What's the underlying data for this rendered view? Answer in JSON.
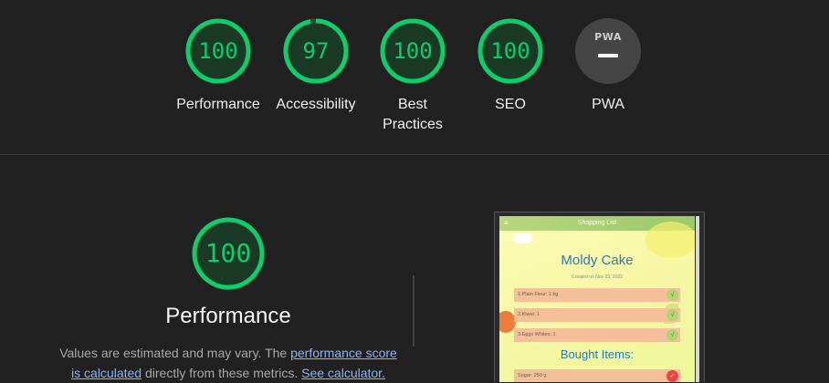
{
  "gauges": [
    {
      "label": "Performance",
      "score": "100",
      "fraction": 1.0
    },
    {
      "label": "Accessibility",
      "score": "97",
      "fraction": 0.97
    },
    {
      "label": "Best Practices",
      "score": "100",
      "fraction": 1.0
    },
    {
      "label": "SEO",
      "score": "100",
      "fraction": 1.0
    },
    {
      "label": "PWA",
      "badge": "PWA"
    }
  ],
  "colors": {
    "pass": "#0cce6b",
    "pass_fill": "#1b3a26",
    "pwa_bg": "#454545",
    "link": "#8ab4f8"
  },
  "performance": {
    "score": "100",
    "title": "Performance",
    "desc_before": "Values are estimated and may vary. The ",
    "link_score": "performance score is calculated",
    "desc_mid": " directly from these metrics. ",
    "link_calc": "See calculator."
  },
  "preview": {
    "appbar_title": "Shopping List",
    "menu_icon": "hamburger-menu-icon",
    "cake_title": "Moldy Cake",
    "created": "Created on Nov 23, 2022",
    "items": [
      "1.Plain Flour: 1 kg",
      "2.Kiwel: 1",
      "3.Eggs Whites: 1"
    ],
    "bought_title": "Bought Items:",
    "bought_items": [
      "Sugar: 250 g"
    ]
  }
}
